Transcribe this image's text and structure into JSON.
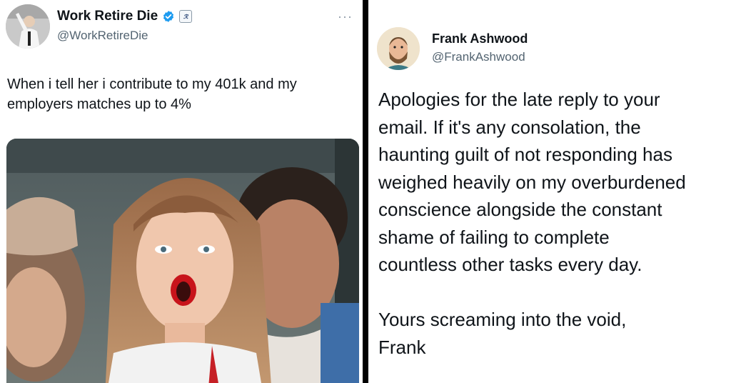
{
  "left_tweet": {
    "display_name": "Work Retire Die",
    "handle": "@WorkRetireDie",
    "more_glyph": "···",
    "affiliate_badge": "ℛ",
    "text": "When i tell her i contribute to my 401k and my employers matches up to 4%",
    "icons": [
      "avatar",
      "verified-badge-icon",
      "affiliate-badge-icon",
      "more-options-icon"
    ],
    "colors": {
      "verified": "#1d9bf0",
      "handle": "#536471",
      "text": "#0f1419"
    }
  },
  "right_tweet": {
    "display_name": "Frank Ashwood",
    "handle": "@FrankAshwood",
    "lines": [
      "Apologies for the late reply to your",
      "email. If it's any consolation, the",
      "haunting guilt of not responding has",
      "weighed heavily on my overburdened",
      "conscience alongside the constant",
      "shame of failing to complete",
      "countless other tasks every day."
    ],
    "closing_lines": [
      "Yours screaming into the void,",
      "Frank"
    ]
  }
}
